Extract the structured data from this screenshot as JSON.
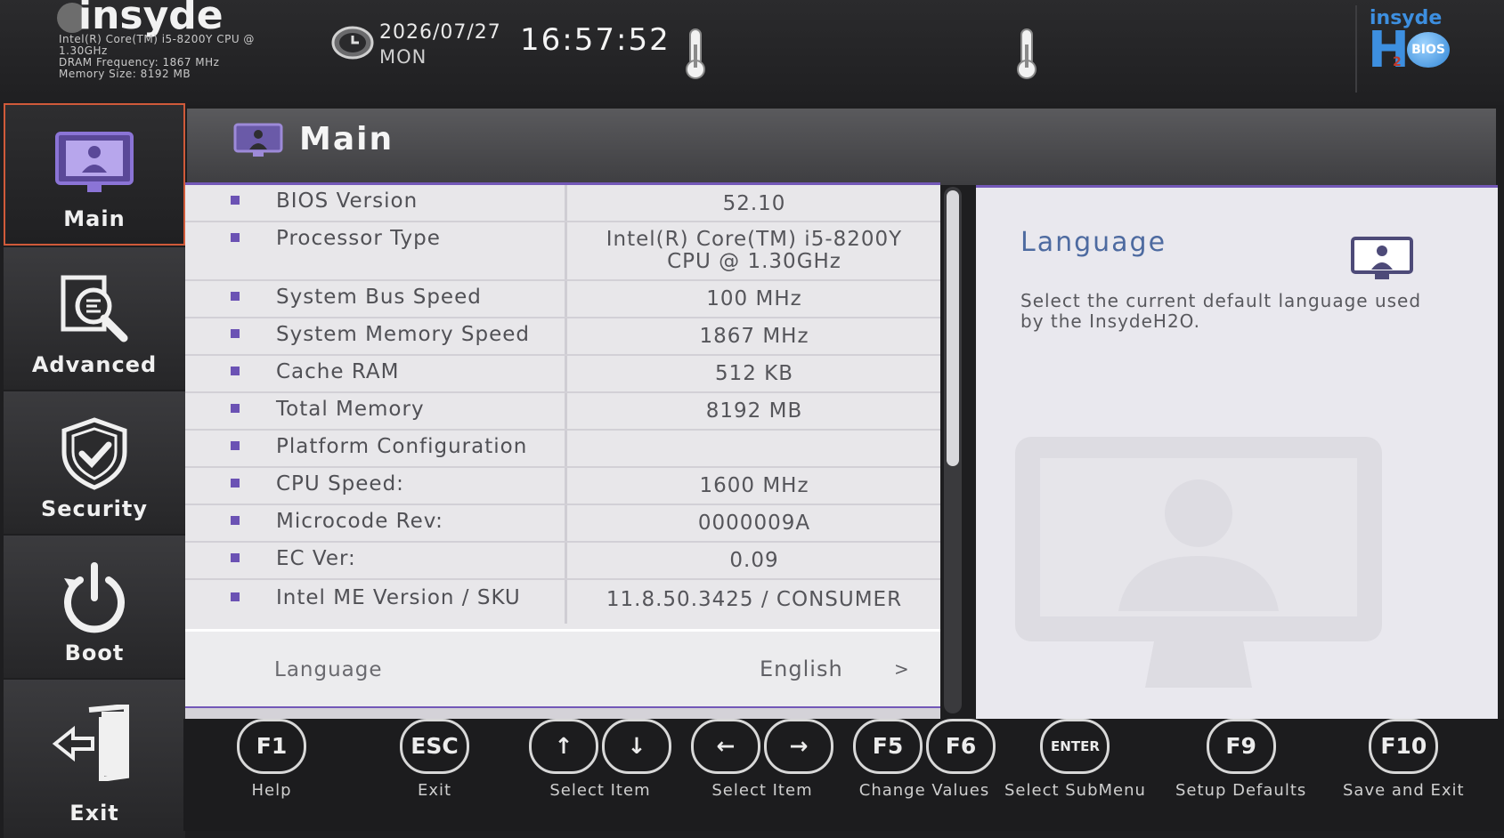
{
  "header": {
    "logo_text": "insyde",
    "sys_info": [
      "Intel(R) Core(TM) i5-8200Y CPU @",
      "1.30GHz",
      "DRAM Frequency: 1867 MHz",
      "Memory Size: 8192 MB"
    ],
    "date": "2026/07/27",
    "day": "MON",
    "time": "16:57:52",
    "brand": {
      "line1": "insyde",
      "line2": "H",
      "sub": "2",
      "badge": "BIOS"
    }
  },
  "sidebar": {
    "items": [
      {
        "label": "Main",
        "icon": "monitor-user-icon",
        "active": true
      },
      {
        "label": "Advanced",
        "icon": "magnifier-document-icon",
        "active": false
      },
      {
        "label": "Security",
        "icon": "shield-check-icon",
        "active": false
      },
      {
        "label": "Boot",
        "icon": "power-icon",
        "active": false
      },
      {
        "label": "Exit",
        "icon": "exit-door-icon",
        "active": false
      }
    ]
  },
  "main": {
    "title": "Main",
    "rows": [
      {
        "label": "BIOS Version",
        "value": "52.10"
      },
      {
        "label": "Processor Type",
        "value": "Intel(R) Core(TM) i5-8200Y",
        "value2": "CPU @ 1.30GHz"
      },
      {
        "label": "System Bus Speed",
        "value": "100 MHz"
      },
      {
        "label": "System Memory Speed",
        "value": "1867 MHz"
      },
      {
        "label": "Cache RAM",
        "value": "512 KB"
      },
      {
        "label": "Total Memory",
        "value": "8192 MB"
      },
      {
        "label": "Platform Configuration",
        "value": ""
      },
      {
        "label": "CPU Speed:",
        "value": "1600 MHz"
      },
      {
        "label": "Microcode Rev:",
        "value": "0000009A"
      },
      {
        "label": "EC Ver:",
        "value": "0.09"
      },
      {
        "label": "Intel ME Version / SKU",
        "value": "11.8.50.3425 / CONSUMER"
      }
    ],
    "language": {
      "label": "Language",
      "value": "English",
      "chevron": ">"
    }
  },
  "help": {
    "title": "Language",
    "description": "Select the current default language used by the InsydeH2O."
  },
  "footer": {
    "keys": [
      {
        "caps": [
          "F1"
        ],
        "label": "Help"
      },
      {
        "caps": [
          "ESC"
        ],
        "label": "Exit"
      },
      {
        "caps": [
          "↑",
          "↓"
        ],
        "label": "Select Item"
      },
      {
        "caps": [
          "←",
          "→"
        ],
        "label": "Select Item"
      },
      {
        "caps": [
          "F5",
          "F6"
        ],
        "label": "Change Values"
      },
      {
        "caps": [
          "ENTER"
        ],
        "label": "Select  SubMenu"
      },
      {
        "caps": [
          "F9"
        ],
        "label": "Setup Defaults"
      },
      {
        "caps": [
          "F10"
        ],
        "label": "Save and Exit"
      }
    ]
  },
  "colors": {
    "accent": "#7358b8",
    "active_border": "#d05a3a",
    "help_title": "#4d6aa0"
  }
}
